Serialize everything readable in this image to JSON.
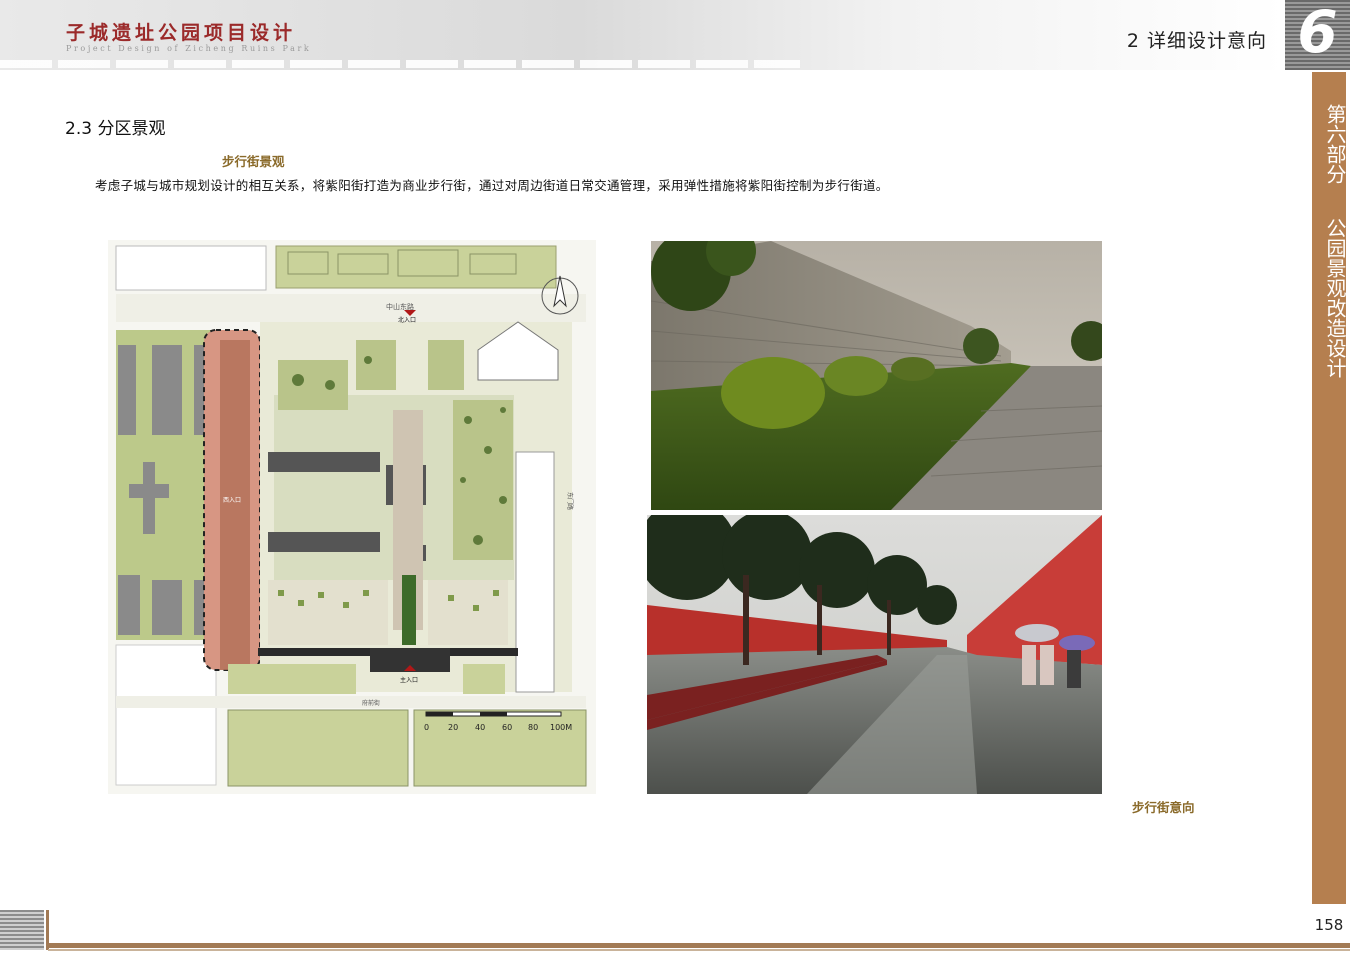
{
  "header": {
    "project_title": "子城遗址公园项目设计",
    "project_subtitle": "Project Design of Zicheng Ruins Park",
    "section": "2 详细设计意向",
    "chapter_number": "6"
  },
  "sidebar": {
    "line1": "第六部分",
    "line2": "公园景观改造设计"
  },
  "content": {
    "sub_heading": "2.3 分区景观",
    "caption_top": "步行街景观",
    "body": "考虑子城与城市规划设计的相互关系，将紫阳街打造为商业步行街，通过对周边街道日常交通管理，采用弹性措施将紫阳街控制为步行街道。",
    "caption_bottom": "步行街意向"
  },
  "plan": {
    "north_entrance": "北入口",
    "south_entrance": "主入口",
    "west_entrance": "西入口",
    "north_road": "中山东路",
    "south_road": "府前街",
    "east_road": "东门路",
    "scale_labels": [
      "0",
      "20",
      "40",
      "60",
      "80",
      "100M"
    ]
  },
  "footer": {
    "page_number": "158"
  },
  "colors": {
    "accent_brown": "#b57f4f",
    "title_red": "#9b2a2a",
    "caption_gold": "#8a6a2a"
  }
}
